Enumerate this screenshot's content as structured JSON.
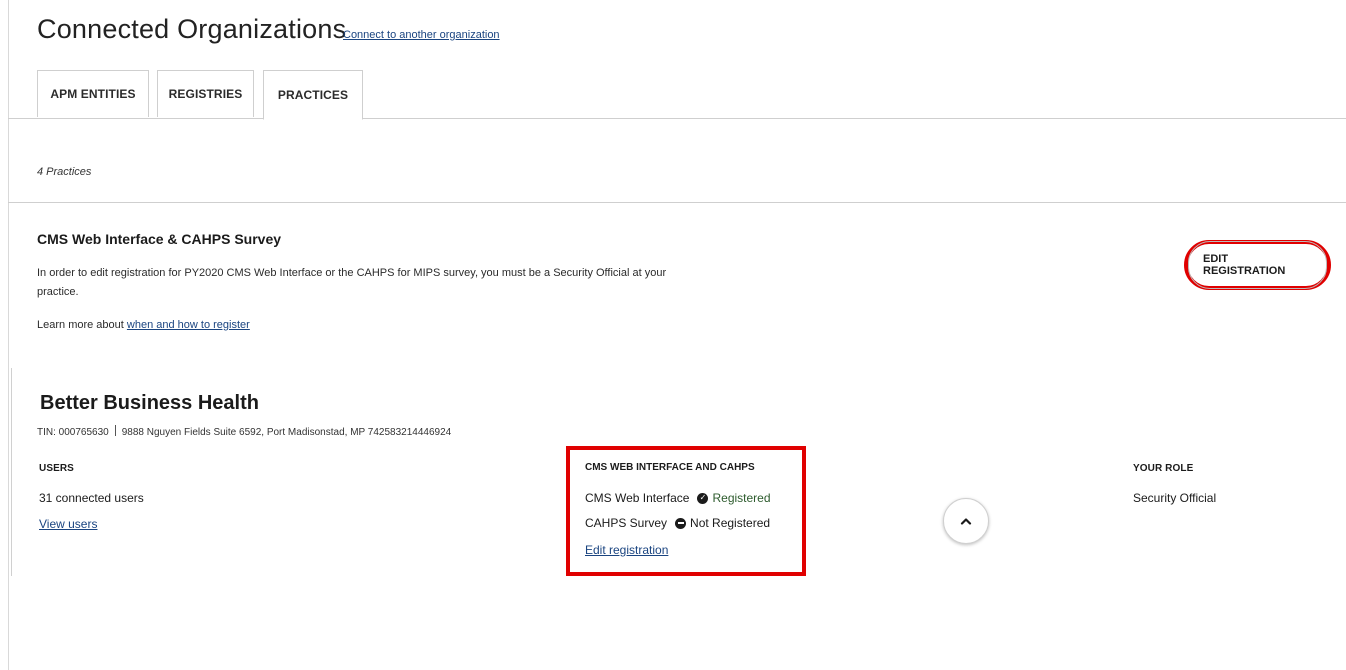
{
  "header": {
    "title": "Connected Organizations",
    "connect_link": "Connect to another organization"
  },
  "tabs": [
    {
      "label": "APM ENTITIES",
      "active": false
    },
    {
      "label": "REGISTRIES",
      "active": false
    },
    {
      "label": "PRACTICES",
      "active": true
    }
  ],
  "practices_count": "4 Practices",
  "cms_section": {
    "title": "CMS Web Interface & CAHPS Survey",
    "description": "In order to edit registration for PY2020 CMS Web Interface or the CAHPS for MIPS survey, you must be a Security Official at your practice.",
    "learn_prefix": "Learn more about",
    "learn_link": "when and how to register",
    "edit_button": "EDIT REGISTRATION"
  },
  "practice": {
    "name": "Better Business Health",
    "tin": "TIN: 000765630",
    "address": "9888 Nguyen Fields Suite 6592, Port Madisonstad, MP 742583214446924",
    "users_header": "USERS",
    "users_count": "31 connected users",
    "view_users": "View users",
    "cms_header": "CMS WEB INTERFACE AND CAHPS",
    "cms_web_label": "CMS Web Interface",
    "cms_web_status": "Registered",
    "cahps_label": "CAHPS Survey",
    "cahps_status": "Not Registered",
    "edit_registration": "Edit registration",
    "role_header": "YOUR ROLE",
    "role_value": "Security Official"
  },
  "icons": {
    "registered": "check-circle-icon",
    "not_registered": "minus-circle-icon",
    "collapse": "chevron-up-icon"
  },
  "colors": {
    "highlight": "#e00000",
    "link": "#1a4480"
  }
}
